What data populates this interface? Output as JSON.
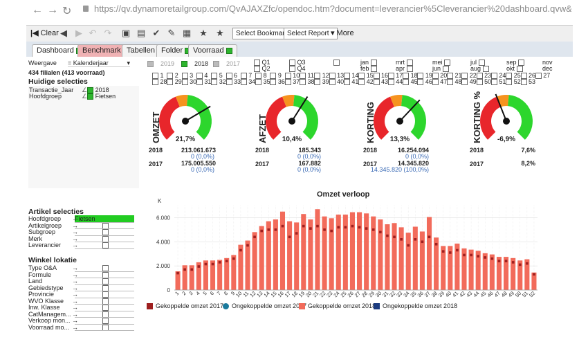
{
  "browser": {
    "url": "https://qv.dynamoretailgroup.com/QvAJAXZfc/opendoc.htm?document=leverancier%5Cleverancier%20dashboard.qvw&lang=en-US&host=QVS%40qv"
  },
  "toolbar": {
    "clear_label": "Clear",
    "select_bookmark": "Select Bookmark",
    "select_report": "Select Report",
    "more_label": "More"
  },
  "tabs": [
    {
      "label": "Dashboard"
    },
    {
      "label": "Benchmark"
    },
    {
      "label": "Tabellen"
    },
    {
      "label": "Folder"
    },
    {
      "label": "Voorraad"
    }
  ],
  "left": {
    "weergave_label": "Weergave",
    "weergave_value": "= Kalenderjaar",
    "filialen": "434 filialen (413 voorraad)",
    "huidige_title": "Huidige selecties",
    "current": [
      {
        "field": "Transactie_Jaar",
        "value": "2018"
      },
      {
        "field": "Hoofdgroep",
        "value": "Fietsen"
      }
    ],
    "artikel_title": "Artikel selecties",
    "artikel": [
      {
        "field": "Hoofdgroep",
        "value": "Fietsen"
      },
      {
        "field": "Artikelgroep",
        "value": ""
      },
      {
        "field": "Subgroep",
        "value": ""
      },
      {
        "field": "Merk",
        "value": ""
      },
      {
        "field": "Leverancier",
        "value": ""
      }
    ],
    "winkel_title": "Winkel lokatie",
    "winkel": [
      "Type O&A",
      "Formule",
      "Land",
      "Gebiedstype",
      "Provincie",
      "WVO Klasse",
      "Inw. Klasse",
      "CatManagem...",
      "Verkoop mon...",
      "Voorraad mo..."
    ]
  },
  "years": [
    "2019",
    "2018",
    "2017"
  ],
  "quarters": [
    "Q1",
    "Q3",
    "Q2",
    "Q4"
  ],
  "months_row1": [
    "jan",
    "mrt",
    "mei",
    "jul",
    "sep",
    "nov"
  ],
  "months_row2": [
    "feb",
    "apr",
    "jun",
    "aug",
    "okt",
    "dec"
  ],
  "weeks_row1": [
    "1",
    "2",
    "3",
    "4",
    "5",
    "6",
    "7",
    "8",
    "9",
    "10",
    "11",
    "12",
    "13",
    "14",
    "15",
    "16",
    "17",
    "18",
    "19",
    "20",
    "21",
    "22",
    "23",
    "24",
    "25",
    "26",
    "27"
  ],
  "weeks_row2": [
    "28",
    "29",
    "30",
    "31",
    "32",
    "33",
    "34",
    "35",
    "36",
    "37",
    "38",
    "39",
    "40",
    "41",
    "42",
    "43",
    "44",
    "45",
    "46",
    "47",
    "48",
    "49",
    "50",
    "51",
    "52",
    "53"
  ],
  "gauges": [
    {
      "title": "OMZET",
      "pct": "21,7%",
      "needle": 0.72,
      "r2018_label": "2018",
      "r2018_value": "213.061.673",
      "r2018_sub": "0 (0,0%)",
      "r2017_label": "2017",
      "r2017_value": "175.005.550",
      "r2017_sub": "0 (0,0%)"
    },
    {
      "title": "AFZET",
      "pct": "10,4%",
      "needle": 0.62,
      "r2018_label": "2018",
      "r2018_value": "185.343",
      "r2018_sub": "0 (0,0%)",
      "r2017_label": "2017",
      "r2017_value": "167.882",
      "r2017_sub": "0 (0,0%)"
    },
    {
      "title": "KORTING",
      "pct": "13,3%",
      "needle": 0.66,
      "r2018_label": "2018",
      "r2018_value": "16.254.094",
      "r2018_sub": "0 (0,0%)",
      "r2017_label": "2017",
      "r2017_value": "14.345.820",
      "r2017_sub": "14.345.820 (100,0%)"
    },
    {
      "title": "KORTING %",
      "pct": "-6,9%",
      "needle": 0.42,
      "r2018_label": "2018",
      "r2018_value": "7,6%",
      "r2018_sub": "",
      "r2017_label": "2017",
      "r2017_value": "8,2%",
      "r2017_sub": ""
    }
  ],
  "colors": {
    "bar": "#f26b5b",
    "dot2017": "#9e1f1f",
    "gauge_red": "#e8262b",
    "gauge_orange": "#f6931f",
    "gauge_green": "#2dd62d",
    "tab_green": "#2db52d",
    "sel_green": "#22cc22"
  },
  "chart_data": {
    "type": "bar",
    "title": "Omzet verloop",
    "ylabel": "K",
    "ylim": [
      0,
      7000
    ],
    "yticks": [
      "0",
      "2.000",
      "4.000",
      "6.000"
    ],
    "categories": [
      "1",
      "2",
      "3",
      "4",
      "5",
      "6",
      "7",
      "8",
      "9",
      "10",
      "11",
      "12",
      "13",
      "14",
      "15",
      "16",
      "17",
      "18",
      "19",
      "20",
      "21",
      "22",
      "23",
      "24",
      "25",
      "26",
      "27",
      "28",
      "29",
      "30",
      "31",
      "32",
      "33",
      "34",
      "35",
      "36",
      "37",
      "38",
      "39",
      "40",
      "41",
      "42",
      "43",
      "44",
      "45",
      "46",
      "47",
      "48",
      "49",
      "50",
      "51",
      "52"
    ],
    "series": [
      {
        "name": "Gekoppelde omzet 2018",
        "values": [
          1550,
          2050,
          2050,
          2300,
          2450,
          2450,
          2500,
          2650,
          2900,
          3750,
          4100,
          4800,
          5300,
          5700,
          5850,
          6500,
          5700,
          5600,
          6300,
          5850,
          6700,
          6100,
          5950,
          6250,
          6250,
          6450,
          6450,
          6350,
          6100,
          5850,
          5450,
          5550,
          5200,
          4750,
          5250,
          4850,
          6050,
          4350,
          3650,
          3650,
          3850,
          3450,
          3350,
          3250,
          3050,
          2950,
          2750,
          2750,
          2650,
          2450,
          2550,
          1450
        ]
      },
      {
        "name": "Gekoppelde omzet 2017",
        "values": [
          1400,
          1700,
          1700,
          1950,
          2150,
          2150,
          2300,
          2400,
          2600,
          3300,
          3700,
          4400,
          4900,
          5000,
          5000,
          5300,
          4400,
          4700,
          5300,
          5100,
          5300,
          5000,
          4900,
          5200,
          5200,
          5300,
          5200,
          5100,
          5000,
          4800,
          4500,
          4400,
          4200,
          3700,
          4200,
          4000,
          4400,
          3800,
          3200,
          3100,
          3300,
          2900,
          2900,
          2800,
          2700,
          2600,
          2400,
          2400,
          2300,
          2100,
          2200,
          1300
        ]
      }
    ],
    "legend": [
      "Gekoppelde omzet 2017",
      "Ongekoppelde omzet 2017",
      "Gekoppelde omzet 2018",
      "Ongekoppelde omzet 2018"
    ]
  }
}
